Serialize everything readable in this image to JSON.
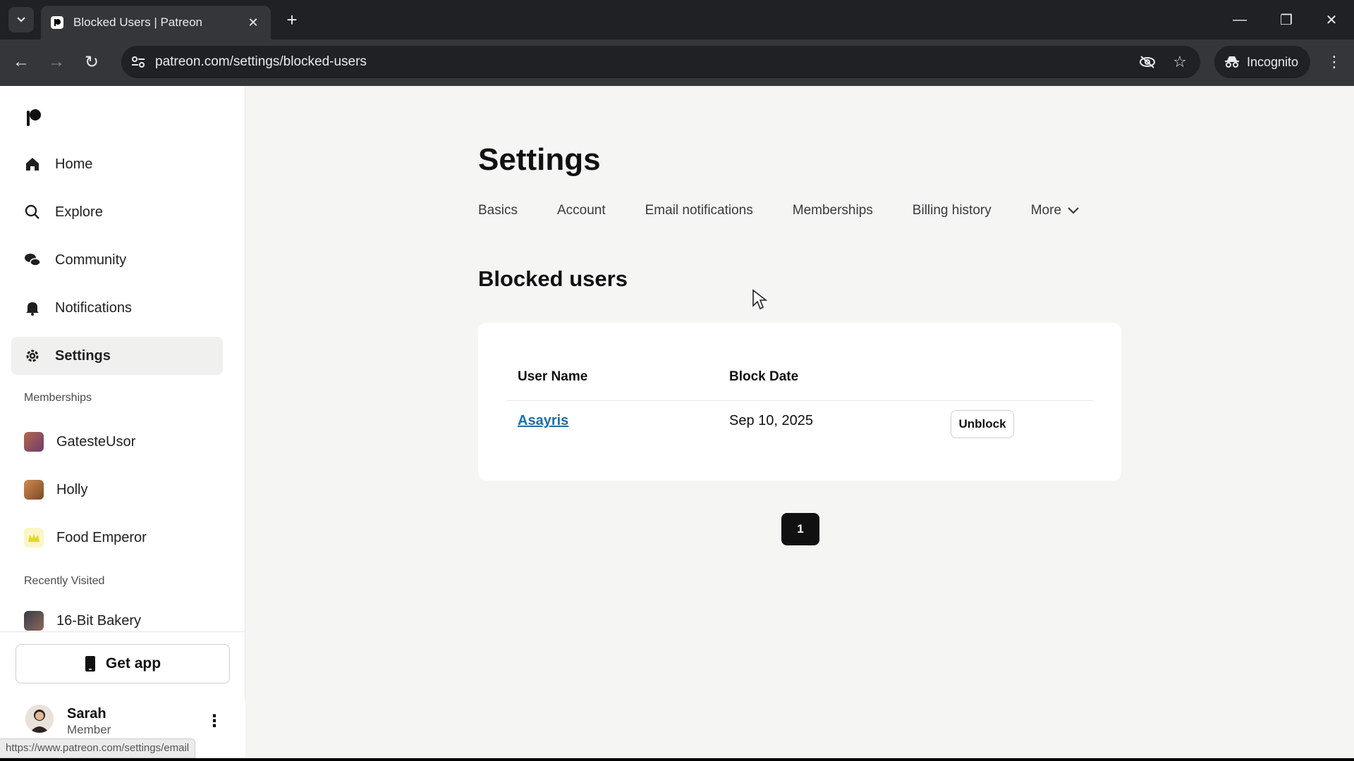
{
  "browser": {
    "tab_title": "Blocked Users | Patreon",
    "url": "patreon.com/settings/blocked-users",
    "incognito_label": "Incognito"
  },
  "sidebar": {
    "nav": [
      {
        "label": "Home",
        "icon": "home-icon"
      },
      {
        "label": "Explore",
        "icon": "search-icon"
      },
      {
        "label": "Community",
        "icon": "chat-icon"
      },
      {
        "label": "Notifications",
        "icon": "bell-icon"
      },
      {
        "label": "Settings",
        "icon": "gear-icon",
        "active": true
      }
    ],
    "memberships_label": "Memberships",
    "memberships": [
      {
        "label": "GatesteUsor"
      },
      {
        "label": "Holly"
      },
      {
        "label": "Food Emperor"
      }
    ],
    "recently_visited_label": "Recently Visited",
    "recently_visited": [
      {
        "label": "16-Bit Bakery"
      }
    ],
    "get_app_label": "Get app",
    "user": {
      "name": "Sarah",
      "role": "Member"
    },
    "status_url": "https://www.patreon.com/settings/email"
  },
  "main": {
    "title": "Settings",
    "tabs": [
      {
        "label": "Basics"
      },
      {
        "label": "Account"
      },
      {
        "label": "Email notifications"
      },
      {
        "label": "Memberships"
      },
      {
        "label": "Billing history"
      }
    ],
    "more_label": "More",
    "section_title": "Blocked users",
    "table": {
      "headers": [
        "User Name",
        "Block Date"
      ],
      "rows": [
        {
          "user": "Asayris",
          "date": "Sep 10, 2025",
          "action": "Unblock"
        }
      ]
    },
    "pagination": {
      "current_page": "1"
    }
  },
  "colors": {
    "link": "#1c6fa9",
    "page_bg": "#f5f5f4",
    "chrome_dark": "#202124"
  }
}
